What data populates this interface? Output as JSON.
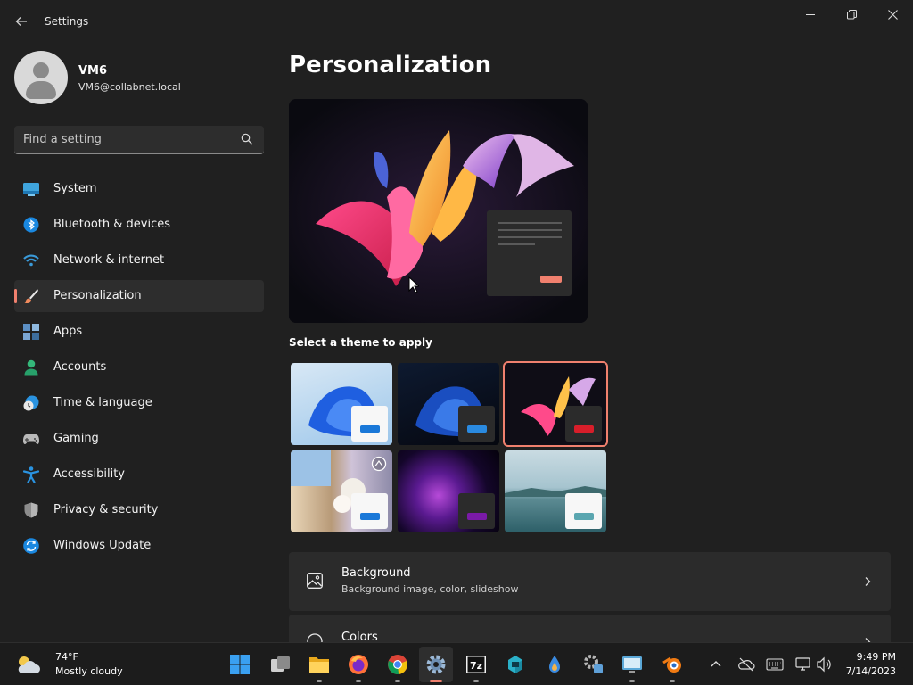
{
  "window": {
    "title": "Settings",
    "minimize_icon": "minimize-icon",
    "restore_icon": "restore-icon",
    "close_icon": "close-icon"
  },
  "user": {
    "name": "VM6",
    "email": "VM6@collabnet.local"
  },
  "search": {
    "placeholder": "Find a setting"
  },
  "sidebar": {
    "items": [
      {
        "label": "System",
        "icon": "system-icon"
      },
      {
        "label": "Bluetooth & devices",
        "icon": "bluetooth-icon"
      },
      {
        "label": "Network & internet",
        "icon": "wifi-icon"
      },
      {
        "label": "Personalization",
        "icon": "brush-icon",
        "active": true
      },
      {
        "label": "Apps",
        "icon": "apps-icon"
      },
      {
        "label": "Accounts",
        "icon": "accounts-icon"
      },
      {
        "label": "Time & language",
        "icon": "clock-globe-icon"
      },
      {
        "label": "Gaming",
        "icon": "gamepad-icon"
      },
      {
        "label": "Accessibility",
        "icon": "accessibility-icon"
      },
      {
        "label": "Privacy & security",
        "icon": "shield-icon"
      },
      {
        "label": "Windows Update",
        "icon": "update-icon"
      }
    ]
  },
  "main": {
    "title": "Personalization",
    "themes_label": "Select a theme to apply",
    "themes": [
      {
        "name": "theme-windows-light",
        "selected": false
      },
      {
        "name": "theme-windows-dark",
        "selected": false
      },
      {
        "name": "theme-glow",
        "selected": true
      },
      {
        "name": "theme-captured-motion",
        "selected": false
      },
      {
        "name": "theme-flow",
        "selected": false
      },
      {
        "name": "theme-sunrise",
        "selected": false
      }
    ],
    "settings": [
      {
        "title": "Background",
        "subtitle": "Background image, color, slideshow",
        "icon": "image-icon"
      },
      {
        "title": "Colors",
        "subtitle": "",
        "icon": "palette-icon"
      }
    ]
  },
  "taskbar": {
    "weather": {
      "temp": "74°F",
      "desc": "Mostly cloudy"
    },
    "clock": {
      "time": "9:49 PM",
      "date": "7/14/2023"
    },
    "apps": [
      "start",
      "task-view",
      "file-explorer",
      "firefox",
      "chrome",
      "settings",
      "7zip",
      "app-cube",
      "drop-app",
      "control-panel",
      "remote-desktop",
      "blender"
    ]
  },
  "colors": {
    "accent": "#f0806e",
    "background": "#202020",
    "card": "#2b2b2b"
  }
}
